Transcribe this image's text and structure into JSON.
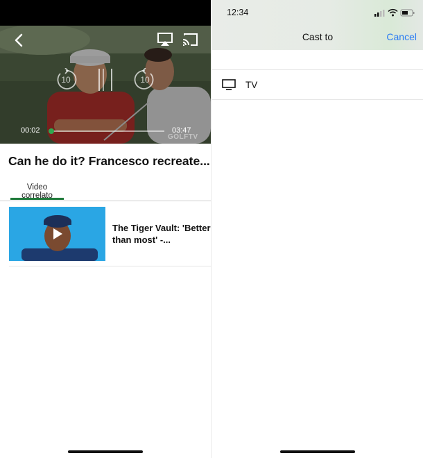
{
  "left": {
    "player": {
      "current_time": "00:02",
      "duration": "03:47",
      "progress": 0.01,
      "skip_back_seconds": "10",
      "skip_forward_seconds": "10",
      "watermark": "GOLFTV"
    },
    "video_title": "Can he do it? Francesco recreate...",
    "tabs": [
      {
        "label": "Video correlato",
        "active": true
      }
    ],
    "related": [
      {
        "title": "The Tiger Vault: 'Better than most' -..."
      }
    ]
  },
  "right": {
    "status_bar": {
      "time": "12:34"
    },
    "cast_sheet": {
      "title": "Cast to",
      "cancel_label": "Cancel",
      "devices": [
        {
          "label": "TV",
          "icon": "tv-icon"
        }
      ]
    }
  },
  "colors": {
    "accent_green": "#1f7a3a",
    "progress_green": "#3cb44a",
    "ios_blue": "#2b7cf3"
  }
}
